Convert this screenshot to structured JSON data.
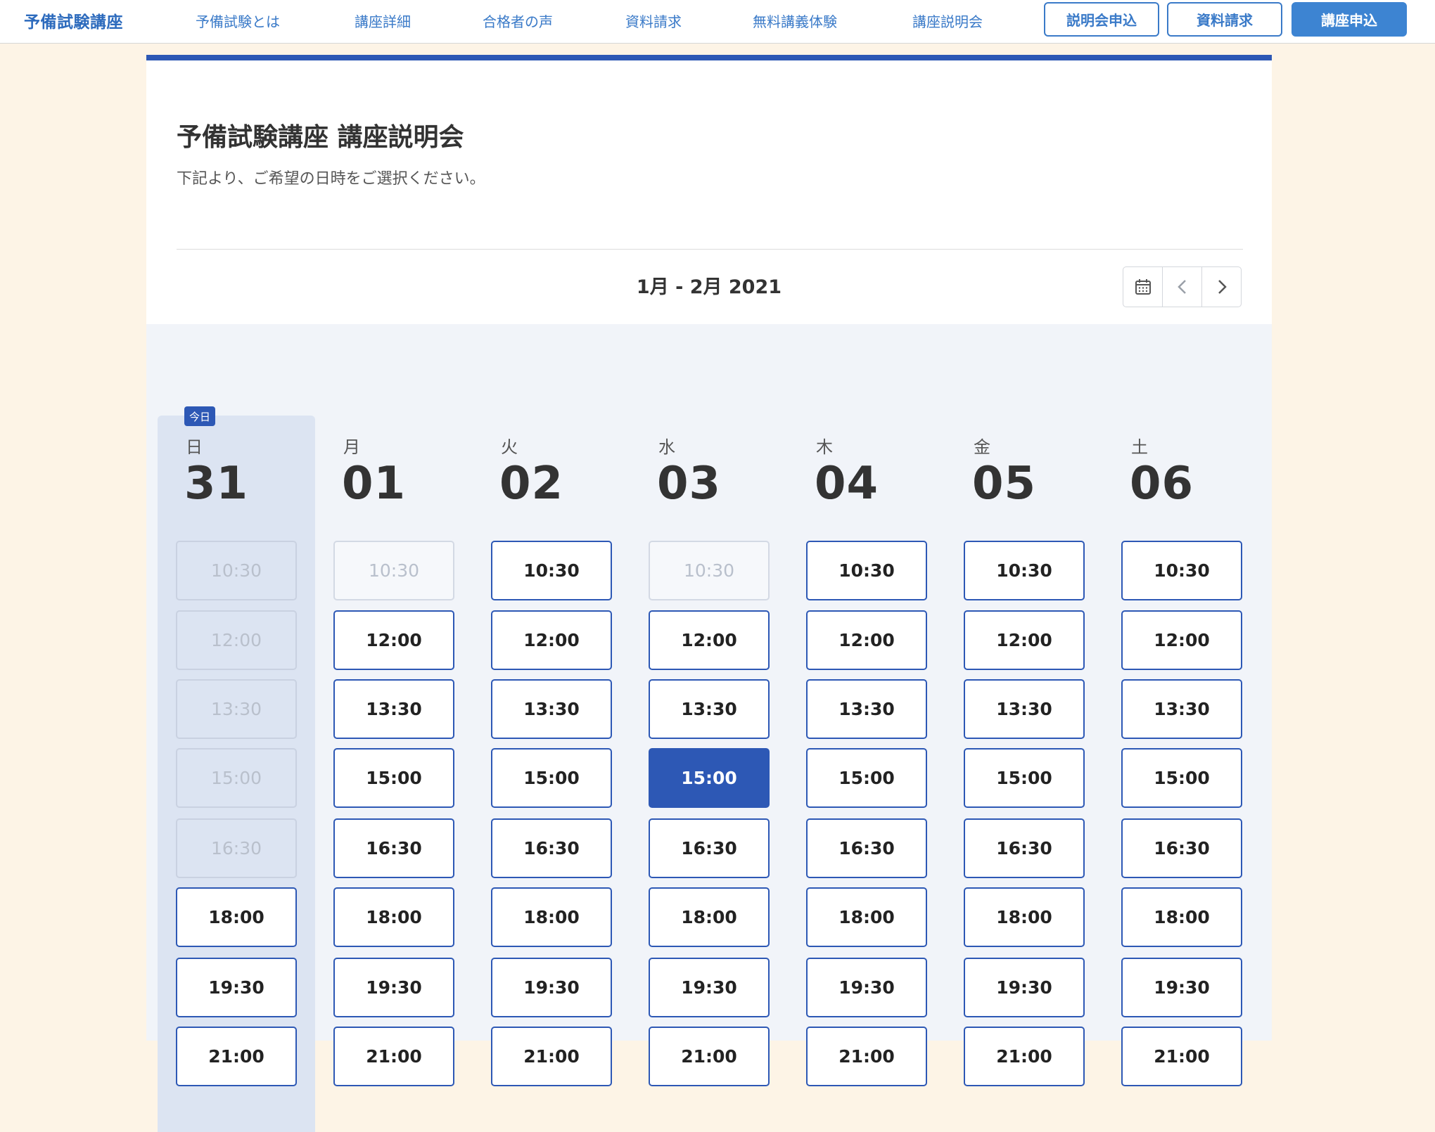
{
  "header": {
    "brand": "予備試験講座",
    "nav": [
      "予備試験とは",
      "講座詳細",
      "合格者の声",
      "資料請求",
      "無料講義体験",
      "講座説明会"
    ],
    "buttons": {
      "seminar": "説明会申込",
      "materials": "資料請求",
      "apply": "講座申込"
    }
  },
  "page": {
    "title": "予備試験講座 講座説明会",
    "subtitle": "下記より、ご希望の日時をご選択ください。",
    "range_label": "1月 - 2月 2021",
    "today_badge": "今日"
  },
  "icons": {
    "calendar": "calendar-icon",
    "prev": "chevron-left-icon",
    "next": "chevron-right-icon"
  },
  "colors": {
    "accent": "#2d58b5",
    "link": "#3a7ac8",
    "background": "#fdf4e6"
  },
  "days": [
    {
      "dow": "日",
      "num": "31",
      "today": true,
      "slots": [
        {
          "time": "10:30",
          "state": "disabled"
        },
        {
          "time": "12:00",
          "state": "disabled"
        },
        {
          "time": "13:30",
          "state": "disabled"
        },
        {
          "time": "15:00",
          "state": "disabled"
        },
        {
          "time": "16:30",
          "state": "disabled"
        },
        {
          "time": "18:00",
          "state": "available"
        },
        {
          "time": "19:30",
          "state": "available"
        },
        {
          "time": "21:00",
          "state": "available"
        }
      ]
    },
    {
      "dow": "月",
      "num": "01",
      "today": false,
      "slots": [
        {
          "time": "10:30",
          "state": "disabled"
        },
        {
          "time": "12:00",
          "state": "available"
        },
        {
          "time": "13:30",
          "state": "available"
        },
        {
          "time": "15:00",
          "state": "available"
        },
        {
          "time": "16:30",
          "state": "available"
        },
        {
          "time": "18:00",
          "state": "available"
        },
        {
          "time": "19:30",
          "state": "available"
        },
        {
          "time": "21:00",
          "state": "available"
        }
      ]
    },
    {
      "dow": "火",
      "num": "02",
      "today": false,
      "slots": [
        {
          "time": "10:30",
          "state": "available"
        },
        {
          "time": "12:00",
          "state": "available"
        },
        {
          "time": "13:30",
          "state": "available"
        },
        {
          "time": "15:00",
          "state": "available"
        },
        {
          "time": "16:30",
          "state": "available"
        },
        {
          "time": "18:00",
          "state": "available"
        },
        {
          "time": "19:30",
          "state": "available"
        },
        {
          "time": "21:00",
          "state": "available"
        }
      ]
    },
    {
      "dow": "水",
      "num": "03",
      "today": false,
      "slots": [
        {
          "time": "10:30",
          "state": "disabled"
        },
        {
          "time": "12:00",
          "state": "available"
        },
        {
          "time": "13:30",
          "state": "available"
        },
        {
          "time": "15:00",
          "state": "selected"
        },
        {
          "time": "16:30",
          "state": "available"
        },
        {
          "time": "18:00",
          "state": "available"
        },
        {
          "time": "19:30",
          "state": "available"
        },
        {
          "time": "21:00",
          "state": "available"
        }
      ]
    },
    {
      "dow": "木",
      "num": "04",
      "today": false,
      "slots": [
        {
          "time": "10:30",
          "state": "available"
        },
        {
          "time": "12:00",
          "state": "available"
        },
        {
          "time": "13:30",
          "state": "available"
        },
        {
          "time": "15:00",
          "state": "available"
        },
        {
          "time": "16:30",
          "state": "available"
        },
        {
          "time": "18:00",
          "state": "available"
        },
        {
          "time": "19:30",
          "state": "available"
        },
        {
          "time": "21:00",
          "state": "available"
        }
      ]
    },
    {
      "dow": "金",
      "num": "05",
      "today": false,
      "slots": [
        {
          "time": "10:30",
          "state": "available"
        },
        {
          "time": "12:00",
          "state": "available"
        },
        {
          "time": "13:30",
          "state": "available"
        },
        {
          "time": "15:00",
          "state": "available"
        },
        {
          "time": "16:30",
          "state": "available"
        },
        {
          "time": "18:00",
          "state": "available"
        },
        {
          "time": "19:30",
          "state": "available"
        },
        {
          "time": "21:00",
          "state": "available"
        }
      ]
    },
    {
      "dow": "土",
      "num": "06",
      "today": false,
      "slots": [
        {
          "time": "10:30",
          "state": "available"
        },
        {
          "time": "12:00",
          "state": "available"
        },
        {
          "time": "13:30",
          "state": "available"
        },
        {
          "time": "15:00",
          "state": "available"
        },
        {
          "time": "16:30",
          "state": "available"
        },
        {
          "time": "18:00",
          "state": "available"
        },
        {
          "time": "19:30",
          "state": "available"
        },
        {
          "time": "21:00",
          "state": "available"
        }
      ]
    }
  ]
}
